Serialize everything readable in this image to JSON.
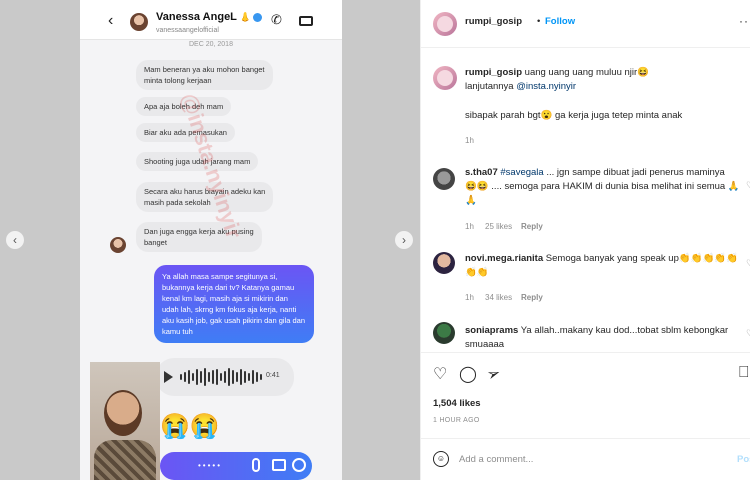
{
  "media": {
    "chat": {
      "contact_name": "Vanessa AngeL",
      "name_emoji": "👃",
      "contact_handle": "vanessaangelofficial",
      "date_divider": "DEC 20, 2018",
      "incoming": [
        "Mam beneran ya aku mohon banget\nminta tolong kerjaan",
        "Apa aja boleh deh mam",
        "Biar aku ada pemasukan",
        "Shooting juga udah jarang mam",
        "Secara aku harus biayain adeku kan\nmasih pada sekolah",
        "Dan juga engga kerja aku pusing\nbanget"
      ],
      "outgoing": "Ya allah masa sampe segitunya si, bukannya kerja dari tv? Katanya gamau kenal km lagi, masih aja si mikirin dan udah lah, skrng km fokus aja kerja, nanti aku kasih job, gak usah pikirin dan gila dan kamu tuh",
      "voice_duration": "0:41",
      "reactions": "😭😭"
    },
    "watermark": "@insta.nyinyir"
  },
  "post": {
    "username": "rumpi_gosip",
    "follow_label": "Follow",
    "caption": {
      "username": "rumpi_gosip",
      "line1": "uang uang uang muluu njir😆",
      "line2_prefix": "lanjutannya ",
      "line2_mention": "@insta.nyinyir",
      "line3": "sibapak parah bgt😮 ga kerja juga tetep minta anak",
      "time": "1h"
    },
    "comments": [
      {
        "username": "s.tha07",
        "hashtag": "#savegala",
        "text1": " ... jgn sampe dibuat jadi penerus maminya",
        "text2": "😆😆 .... semoga para HAKIM di dunia bisa melihat ini semua 🙏",
        "text3": "🙏",
        "time": "1h",
        "likes": "25 likes",
        "reply": "Reply"
      },
      {
        "username": "novi.mega.rianita",
        "text1": " Semoga banyak yang speak up👏👏👏👏👏",
        "text2": "👏👏",
        "time": "1h",
        "likes": "34 likes",
        "reply": "Reply"
      },
      {
        "username": "soniaprams",
        "text1": " Ya allah..makany kau dod...tobat sblm kebongkar",
        "text2": "smuaaaa"
      }
    ],
    "likes": "1,504 likes",
    "time_ago": "1 HOUR AGO",
    "comment_placeholder": "Add a comment...",
    "post_label": "Post"
  }
}
